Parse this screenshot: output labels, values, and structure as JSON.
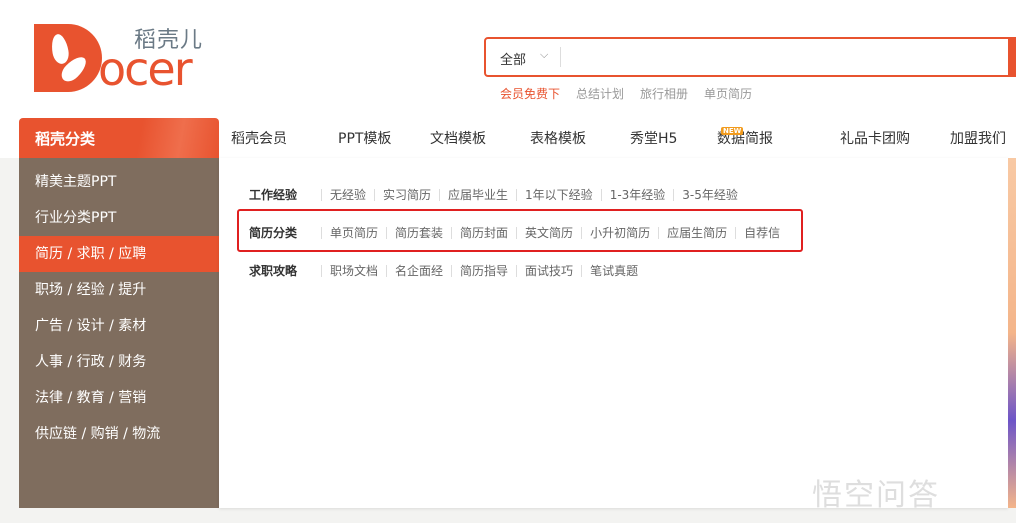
{
  "logo": {
    "cn": "稻壳儿",
    "en": "ocer"
  },
  "search": {
    "scope": "全部",
    "value": "",
    "hot": [
      "会员免费下",
      "总结计划",
      "旅行相册",
      "单页简历"
    ]
  },
  "category_title": "稻壳分类",
  "nav": [
    {
      "label": "稻壳会员"
    },
    {
      "label": "PPT模板"
    },
    {
      "label": "文档模板"
    },
    {
      "label": "表格模板"
    },
    {
      "label": "秀堂H5"
    },
    {
      "label": "数据简报",
      "badge": "NEW"
    },
    {
      "label": "礼品卡团购"
    },
    {
      "label": "加盟我们"
    }
  ],
  "sidebar": [
    "精美主题PPT",
    "行业分类PPT",
    "简历 / 求职 / 应聘",
    "职场 / 经验 / 提升",
    "广告 / 设计 / 素材",
    "人事 / 行政 / 财务",
    "法律 / 教育 / 营销",
    "供应链 / 购销 / 物流"
  ],
  "panel": [
    {
      "title": "工作经验",
      "items": [
        "无经验",
        "实习简历",
        "应届毕业生",
        "1年以下经验",
        "1-3年经验",
        "3-5年经验"
      ]
    },
    {
      "title": "简历分类",
      "items": [
        "单页简历",
        "简历套装",
        "简历封面",
        "英文简历",
        "小升初简历",
        "应届生简历",
        "自荐信"
      ]
    },
    {
      "title": "求职攻略",
      "items": [
        "职场文档",
        "名企面经",
        "简历指导",
        "面试技巧",
        "笔试真题"
      ]
    }
  ],
  "watermark": "悟空问答"
}
